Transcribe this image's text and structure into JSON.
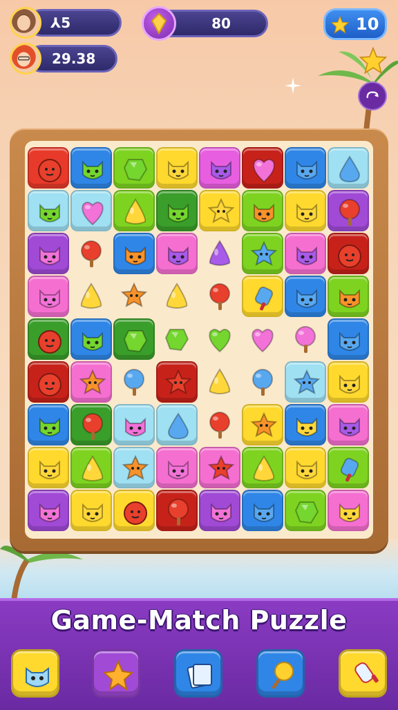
{
  "hud": {
    "player1_lives": "⅄5",
    "player2_timer": "29.38",
    "gems": "80",
    "stars": "10"
  },
  "title": "Game-Match Puzzle",
  "colors": {
    "red": "#e83a2a",
    "blue": "#2f86e6",
    "green": "#7ed321",
    "yellow": "#ffd92e",
    "magenta": "#e85ee0",
    "purple": "#a04ad6",
    "lightblue": "#9fe0f2",
    "darkgreen": "#3a9e2a",
    "pink": "#f56fd0",
    "darkred": "#c7221a",
    "orange": "#f79a2c",
    "cream": "#fbe9cc"
  },
  "board": {
    "rows": [
      [
        [
          "red",
          "red-blob"
        ],
        [
          "blue",
          "green-cat"
        ],
        [
          "green",
          "green-gem"
        ],
        [
          "yellow",
          "yellow-cat"
        ],
        [
          "magenta",
          "purple-cat"
        ],
        [
          "darkred",
          "pink-heart"
        ],
        [
          "blue",
          "blue-cat"
        ],
        [
          "lightblue",
          "blue-drop"
        ]
      ],
      [
        [
          "lightblue",
          "green-cat"
        ],
        [
          "lightblue",
          "pink-heart"
        ],
        [
          "green",
          "yellow-cone"
        ],
        [
          "darkgreen",
          "green-cat"
        ],
        [
          "yellow",
          "yellow-star"
        ],
        [
          "green",
          "orange-cat"
        ],
        [
          "yellow",
          "yellow-cat"
        ],
        [
          "purple",
          "red-lolly"
        ]
      ],
      [
        [
          "purple",
          "pink-cat"
        ],
        [
          "clear",
          "red-lolly"
        ],
        [
          "blue",
          "orange-cat"
        ],
        [
          "pink",
          "purple-cat"
        ],
        [
          "clear",
          "purple-cone"
        ],
        [
          "green",
          "blue-star"
        ],
        [
          "pink",
          "purple-cat"
        ],
        [
          "darkred",
          "red-blob"
        ]
      ],
      [
        [
          "pink",
          "pink-cat"
        ],
        [
          "clear",
          "yellow-cone"
        ],
        [
          "clear",
          "orange-star"
        ],
        [
          "clear",
          "yellow-cone"
        ],
        [
          "clear",
          "red-lolly"
        ],
        [
          "yellow",
          "blue-popsicle"
        ],
        [
          "blue",
          "blue-cat"
        ],
        [
          "green",
          "orange-cat"
        ]
      ],
      [
        [
          "darkgreen",
          "red-blob"
        ],
        [
          "blue",
          "green-cat"
        ],
        [
          "darkgreen",
          "green-gem"
        ],
        [
          "clear",
          "green-gem"
        ],
        [
          "clear",
          "green-heart"
        ],
        [
          "clear",
          "pink-heart"
        ],
        [
          "clear",
          "pink-lolly"
        ],
        [
          "blue",
          "blue-cat"
        ]
      ],
      [
        [
          "darkred",
          "red-blob"
        ],
        [
          "pink",
          "orange-star"
        ],
        [
          "clear",
          "blue-lolly"
        ],
        [
          "darkred",
          "red-star"
        ],
        [
          "clear",
          "yellow-cone"
        ],
        [
          "clear",
          "blue-lolly"
        ],
        [
          "lightblue",
          "blue-star"
        ],
        [
          "yellow",
          "yellow-cat"
        ]
      ],
      [
        [
          "blue",
          "green-cat"
        ],
        [
          "darkgreen",
          "red-lolly"
        ],
        [
          "lightblue",
          "pink-cat"
        ],
        [
          "lightblue",
          "blue-drop"
        ],
        [
          "clear",
          "red-lolly"
        ],
        [
          "yellow",
          "orange-star"
        ],
        [
          "blue",
          "yellow-cat"
        ],
        [
          "pink",
          "purple-cat"
        ]
      ],
      [
        [
          "yellow",
          "yellow-cat"
        ],
        [
          "green",
          "yellow-cone"
        ],
        [
          "lightblue",
          "orange-star"
        ],
        [
          "pink",
          "pink-cat"
        ],
        [
          "pink",
          "red-star"
        ],
        [
          "green",
          "yellow-cone"
        ],
        [
          "yellow",
          "yellow-cat"
        ],
        [
          "green",
          "blue-popsicle"
        ]
      ],
      [
        [
          "purple",
          "pink-cat"
        ],
        [
          "yellow",
          "yellow-cat"
        ],
        [
          "yellow",
          "red-blob"
        ],
        [
          "darkred",
          "red-lolly"
        ],
        [
          "purple",
          "pink-cat"
        ],
        [
          "blue",
          "blue-cat"
        ],
        [
          "green",
          "green-gem"
        ],
        [
          "pink",
          "yellow-cat"
        ]
      ]
    ]
  },
  "tools": [
    {
      "name": "cat-booster",
      "icon": "blue-cat-icon",
      "color": "#ffd92e"
    },
    {
      "name": "star-booster",
      "icon": "star-icon",
      "color": "#a04ad6"
    },
    {
      "name": "shuffle-booster",
      "icon": "cards-icon",
      "color": "#2f86e6"
    },
    {
      "name": "hammer-booster",
      "icon": "lollipop-icon",
      "color": "#2f86e6"
    },
    {
      "name": "popsicle-booster",
      "icon": "popsicle-icon",
      "color": "#ffd92e"
    }
  ]
}
